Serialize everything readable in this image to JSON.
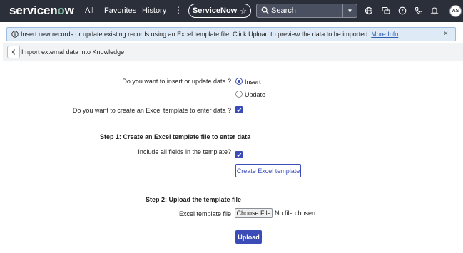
{
  "nav": {
    "logo_text": "servicenow",
    "links": {
      "all": "All",
      "favorites": "Favorites",
      "history": "History"
    },
    "more_icon": "kebab-icon",
    "context_pill": "ServiceNow",
    "search_placeholder": "Search",
    "avatar_initials": "AS",
    "icons": [
      "globe-icon",
      "chat-icon",
      "help-icon",
      "phone-icon",
      "bell-icon"
    ],
    "colors": {
      "bar": "#2b2f3a",
      "logo_accent": "#81b5a1"
    }
  },
  "banner": {
    "text": "Insert new records or update existing records using an Excel template file. Click Upload to preview the data to be imported.",
    "link": "More Info",
    "icon": "info-icon",
    "close": "×"
  },
  "header": {
    "title": "Import external data into Knowledge"
  },
  "form": {
    "mode_question": "Do you want to insert or update data ?",
    "insert_label": "Insert",
    "update_label": "Update",
    "selected_mode": "Insert",
    "create_template_question": "Do you want to create an Excel template to enter data ?",
    "create_template_checked": true,
    "step1_title": "Step   1:  Create an Excel template file to enter data",
    "include_fields_question": "Include all fields in the template?",
    "include_fields_checked": true,
    "create_button": "Create Excel template",
    "step2_title": "Step   2:  Upload the template file",
    "file_label": "Excel template file",
    "choose_file_button": "Choose File",
    "file_status": "No file chosen",
    "upload_button": "Upload",
    "accent_color": "#3b4cb8"
  }
}
